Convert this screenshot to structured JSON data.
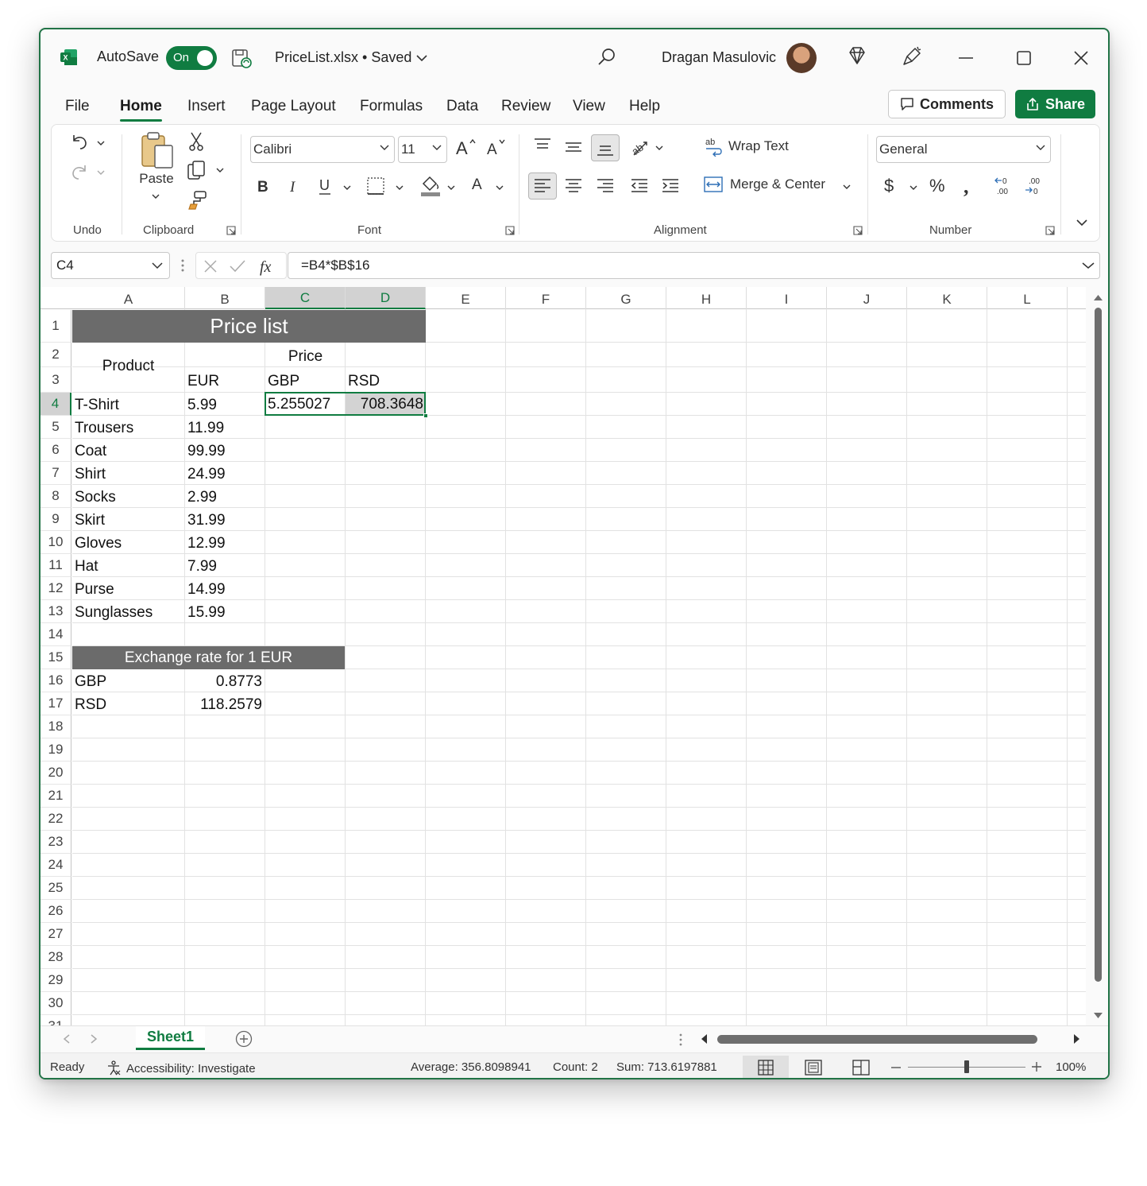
{
  "app": {
    "autosave_label": "AutoSave",
    "autosave_state": "On",
    "file_title": "PriceList.xlsx • Saved",
    "user_name": "Dragan Masulovic"
  },
  "tabs": [
    "File",
    "Home",
    "Insert",
    "Page Layout",
    "Formulas",
    "Data",
    "Review",
    "View",
    "Help"
  ],
  "actions": {
    "comments": "Comments",
    "share": "Share"
  },
  "ribbon": {
    "groups": {
      "undo": "Undo",
      "clipboard": "Clipboard",
      "font": "Font",
      "alignment": "Alignment",
      "number": "Number"
    },
    "paste_label": "Paste",
    "font_name": "Calibri",
    "font_size": "11",
    "wrap_text": "Wrap Text",
    "merge_center": "Merge & Center",
    "number_format": "General"
  },
  "formula_bar": {
    "name_box": "C4",
    "formula": "=B4*$B$16"
  },
  "columns": [
    "A",
    "B",
    "C",
    "D",
    "E",
    "F",
    "G",
    "H",
    "I",
    "J",
    "K",
    "L"
  ],
  "rows": [
    "1",
    "2",
    "3",
    "4",
    "5",
    "6",
    "7",
    "8",
    "9",
    "10",
    "11",
    "12",
    "13",
    "14",
    "15",
    "16",
    "17",
    "18",
    "19",
    "20",
    "21",
    "22",
    "23",
    "24",
    "25",
    "26",
    "27",
    "28",
    "29",
    "30",
    "31"
  ],
  "sheet": {
    "title": "Price list",
    "price_header": "Price",
    "product_header": "Product",
    "currency_headers": [
      "EUR",
      "GBP",
      "RSD"
    ],
    "products": [
      {
        "name": "T-Shirt",
        "eur": "5.99",
        "gbp": "5.255027",
        "rsd": "708.3648"
      },
      {
        "name": "Trousers",
        "eur": "11.99"
      },
      {
        "name": "Coat",
        "eur": "99.99"
      },
      {
        "name": "Shirt",
        "eur": "24.99"
      },
      {
        "name": "Socks",
        "eur": "2.99"
      },
      {
        "name": "Skirt",
        "eur": "31.99"
      },
      {
        "name": "Gloves",
        "eur": "12.99"
      },
      {
        "name": "Hat",
        "eur": "7.99"
      },
      {
        "name": "Purse",
        "eur": "14.99"
      },
      {
        "name": "Sunglasses",
        "eur": "15.99"
      }
    ],
    "exchange_header": "Exchange rate for 1 EUR",
    "rates": [
      {
        "code": "GBP",
        "value": "0.8773"
      },
      {
        "code": "RSD",
        "value": "118.2579"
      }
    ]
  },
  "sheet_tabs": [
    "Sheet1"
  ],
  "status": {
    "ready": "Ready",
    "accessibility": "Accessibility: Investigate",
    "average": "Average: 356.8098941",
    "count": "Count: 2",
    "sum": "Sum: 713.6197881",
    "zoom": "100%",
    "zoom_level": 1.0
  },
  "colors": {
    "brand": "#107c41",
    "header_fill": "#6b6b6b",
    "selection_fill": "#d3d3d3"
  }
}
